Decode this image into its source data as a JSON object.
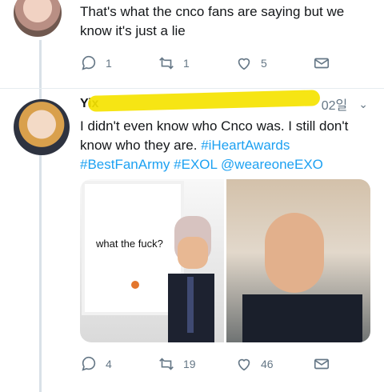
{
  "top_tweet": {
    "text": "That's what the cnco fans are saying but we know it's just a lie",
    "reply_count": "1",
    "retweet_count": "1",
    "like_count": "5"
  },
  "reply_tweet": {
    "name_visible": "Yix",
    "date": "02일",
    "text": "I didn't even know who Cnco was. I still don't know who they are.",
    "hashtags": "#iHeartAwards",
    "hashtags_line2": "#BestFanArmy #EXOL @weareoneEXO",
    "media_left_caption": "what the fuck?",
    "reply_count": "4",
    "retweet_count": "19",
    "like_count": "46"
  },
  "icons": [
    "reply-icon",
    "retweet-icon",
    "like-icon",
    "message-icon",
    "chevron-down-icon"
  ],
  "colors": {
    "link": "#1da1f2",
    "muted": "#657786",
    "redaction": "#f5e300"
  }
}
